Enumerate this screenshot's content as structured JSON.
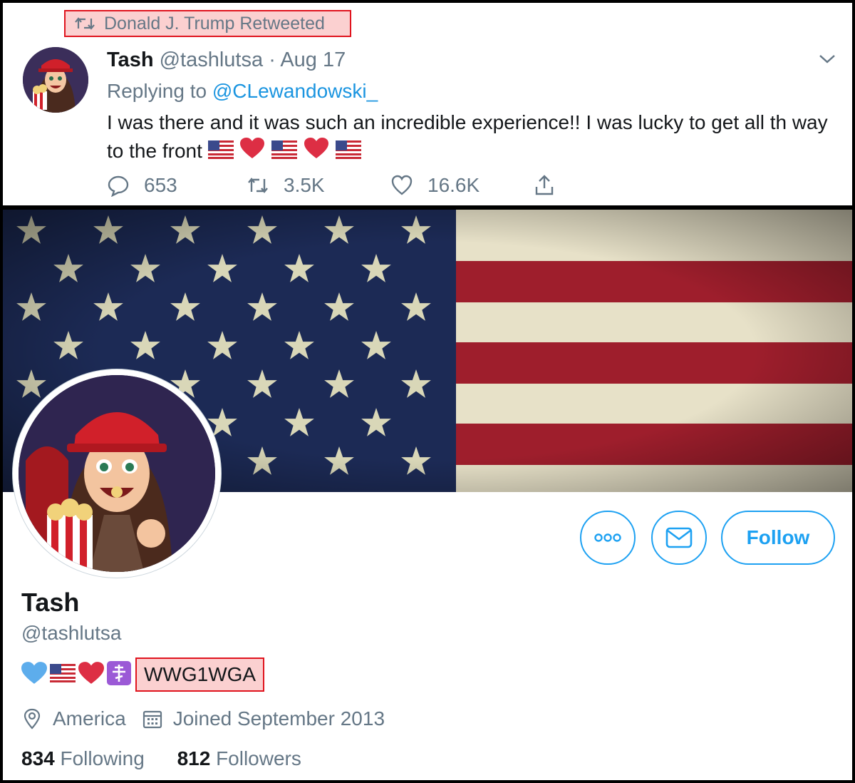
{
  "tweet": {
    "retweet_label": "Donald J. Trump Retweeted",
    "author_name": "Tash",
    "author_handle": "@tashlutsa",
    "separator": "·",
    "date": "Aug 17",
    "replying_prefix": "Replying to",
    "replying_to": "@CLewandowski_",
    "text": "I was there and it was such an incredible experience!! I was lucky to get all th way to the front",
    "emojis": [
      "flag-us-icon",
      "red-heart-icon",
      "flag-us-icon",
      "red-heart-icon",
      "flag-us-icon"
    ],
    "reply_count": "653",
    "retweet_count": "3.5K",
    "like_count": "16.6K"
  },
  "profile": {
    "name": "Tash",
    "handle": "@tashlutsa",
    "bio_emojis": [
      "blue-heart-icon",
      "flag-us-icon",
      "red-heart-icon",
      "orthodox-cross-icon"
    ],
    "bio_tag": "WWG1WGA",
    "location": "America",
    "joined": "Joined September 2013",
    "following_count": "834",
    "following_label": "Following",
    "followers_count": "812",
    "followers_label": "Followers",
    "follow_button": "Follow"
  },
  "colors": {
    "accent": "#1da1f2",
    "highlight_border": "#e0141e",
    "highlight_fill": "#fbd0d0",
    "secondary_text": "#657786"
  }
}
